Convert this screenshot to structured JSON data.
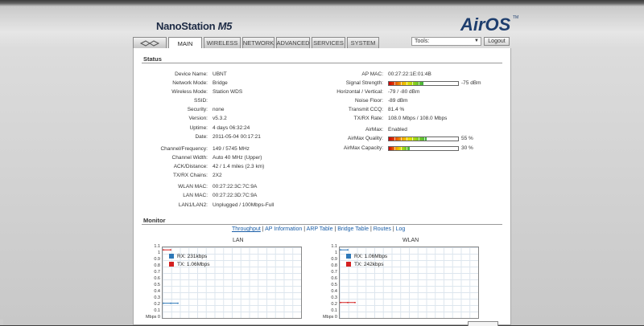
{
  "header": {
    "product_name": "NanoStation",
    "product_model": "M5",
    "os_logo": "AirOS",
    "os_logo_tm": "TM"
  },
  "tabs": [
    {
      "label": "",
      "icon": "ubiquiti-logo-icon"
    },
    {
      "label": "MAIN",
      "active": true
    },
    {
      "label": "WIRELESS"
    },
    {
      "label": "NETWORK"
    },
    {
      "label": "ADVANCED"
    },
    {
      "label": "SERVICES"
    },
    {
      "label": "SYSTEM"
    }
  ],
  "toolbar": {
    "tools_select": "Tools:",
    "logout_label": "Logout"
  },
  "status": {
    "title": "Status",
    "left": [
      {
        "label": "Device Name:",
        "value": "UBNT"
      },
      {
        "label": "Network Mode:",
        "value": "Bridge"
      },
      {
        "label": "Wireless Mode:",
        "value": "Station WDS"
      },
      {
        "label": "SSID:",
        "value": ""
      },
      {
        "label": "Security:",
        "value": "none"
      },
      {
        "label": "Version:",
        "value": "v5.3.2"
      },
      {
        "label": "Uptime:",
        "value": "4 days 06:32:24"
      },
      {
        "label": "Date:",
        "value": "2011-05-04 00:17:21"
      },
      {
        "label": "Channel/Frequency:",
        "value": "149 / 5745 MHz"
      },
      {
        "label": "Channel Width:",
        "value": "Auto 40 MHz (Upper)"
      },
      {
        "label": "ACK/Distance:",
        "value": "42 / 1.4 miles (2.3 km)"
      },
      {
        "label": "TX/RX Chains:",
        "value": "2X2"
      },
      {
        "label": "WLAN MAC:",
        "value": "00:27:22:3C:7C:9A"
      },
      {
        "label": "LAN MAC:",
        "value": "00:27:22:3D:7C:9A"
      },
      {
        "label": "LAN1/LAN2:",
        "value": "Unplugged / 100Mbps-Full"
      }
    ],
    "right": [
      {
        "label": "AP MAC:",
        "value": "00:27:22:1E:01:4B"
      },
      {
        "label": "Signal Strength:",
        "value": "-75 dBm",
        "bar": 0.5
      },
      {
        "label": "Horizontal / Vertical:",
        "value": "-79 / -80 dBm"
      },
      {
        "label": "Noise Floor:",
        "value": "-89 dBm"
      },
      {
        "label": "Transmit CCQ:",
        "value": "81.4 %"
      },
      {
        "label": "TX/RX Rate:",
        "value": "108.0 Mbps / 108.0 Mbps"
      },
      {
        "label": "AirMax:",
        "value": "Enabled"
      },
      {
        "label": "AirMax Quality:",
        "value": "55 %",
        "bar": 0.55
      },
      {
        "label": "AirMax Capacity:",
        "value": "30 %",
        "bar": 0.3
      }
    ]
  },
  "monitor": {
    "title": "Monitor",
    "links": [
      "Throughput",
      "AP Information",
      "ARP Table",
      "Bridge Table",
      "Routes",
      "Log"
    ],
    "separator": " | ",
    "charts": [
      {
        "title": "LAN",
        "legend": [
          {
            "label": "RX: 231kbps",
            "color": "#2e78b8"
          },
          {
            "label": "TX: 1.06Mbps",
            "color": "#d42020"
          }
        ]
      },
      {
        "title": "WLAN",
        "legend": [
          {
            "label": "RX: 1.06Mbps",
            "color": "#2e78b8"
          },
          {
            "label": "TX: 242kbps",
            "color": "#d42020"
          }
        ]
      }
    ],
    "y_ticks": [
      "1.1",
      "1",
      "0.9",
      "0.8",
      "0.7",
      "0.6",
      "0.5",
      "0.4",
      "0.3",
      "0.2",
      "0.1",
      "Mbps 0"
    ]
  },
  "chart_data": [
    {
      "type": "line",
      "title": "LAN",
      "ylim": [
        0,
        1.1
      ],
      "yunit": "Mbps",
      "series": [
        {
          "name": "RX: 231kbps",
          "values": [
            0.23,
            0.23,
            0.23
          ]
        },
        {
          "name": "TX: 1.06Mbps",
          "values": [
            1.06,
            1.06
          ]
        }
      ]
    },
    {
      "type": "line",
      "title": "WLAN",
      "ylim": [
        0,
        1.1
      ],
      "yunit": "Mbps",
      "series": [
        {
          "name": "RX: 1.06Mbps",
          "values": [
            1.06,
            1.06
          ]
        },
        {
          "name": "TX: 242kbps",
          "values": [
            0.24,
            0.24,
            0.24
          ]
        }
      ]
    }
  ]
}
